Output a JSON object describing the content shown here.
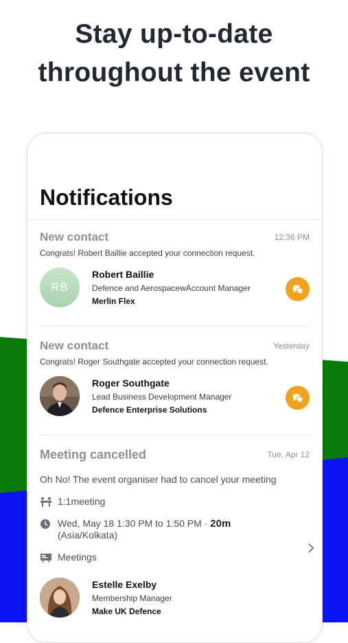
{
  "headline": {
    "line1": "Stay up-to-date",
    "line2": "throughout the event"
  },
  "screen": {
    "title": "Notifications",
    "notifications": [
      {
        "type": "New contact",
        "time": "12:36 PM",
        "message": "Congrats! Robert Baillie accepted your connection request.",
        "person": {
          "initials": "RB",
          "name": "Robert Baillie",
          "role": "Defence and AerospacewAccount Manager",
          "org": "Merlin Flex"
        }
      },
      {
        "type": "New contact",
        "time": "Yesterday",
        "message": "Congrats! Roger Southgate accepted your connection request.",
        "person": {
          "name": "Roger Southgate",
          "role": "Lead Business Development Manager",
          "org": "Defence Enterprise Solutions"
        }
      },
      {
        "type": "Meeting cancelled",
        "time": "Tue, Apr 12",
        "message": "Oh No! The event organiser had to cancel your meeting",
        "meeting_type": "1:1meeting",
        "datetime": "Wed, May 18 1:30 PM to 1:50 PM",
        "separator": "·",
        "duration": "20m",
        "timezone": "(Asia/Kolkata)",
        "location": "Meetings",
        "person": {
          "name": "Estelle Exelby",
          "role": "Membership Manager",
          "org": "Make UK Defence"
        }
      }
    ]
  },
  "colors": {
    "accent_orange": "#f0a21f",
    "bg_green": "#0a7a0a",
    "bg_blue": "#0a14f0"
  }
}
